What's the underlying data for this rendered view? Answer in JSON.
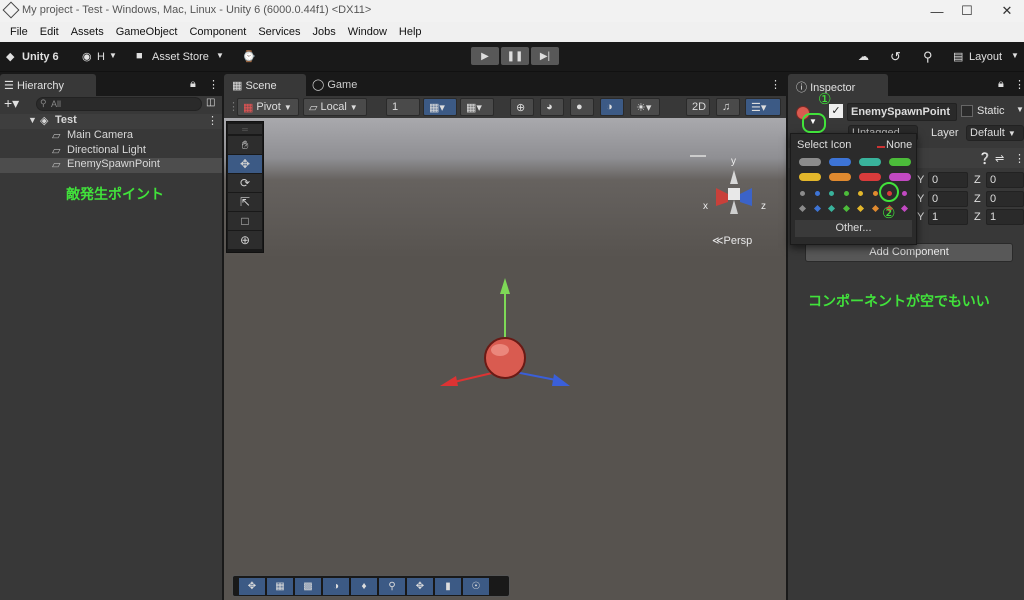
{
  "window": {
    "title": "My project - Test - Windows, Mac, Linux - Unity 6 (6000.0.44f1) <DX11>"
  },
  "menu": [
    "File",
    "Edit",
    "Assets",
    "GameObject",
    "Component",
    "Services",
    "Jobs",
    "Window",
    "Help"
  ],
  "toolbar": {
    "unity_label": "Unity 6",
    "account_label": "H",
    "asset_store_label": "Asset Store",
    "layout_label": "Layout"
  },
  "hierarchy": {
    "tab_label": "Hierarchy",
    "search_placeholder": "All",
    "scene_name": "Test",
    "items": [
      "Main Camera",
      "Directional Light",
      "EnemySpawnPoint"
    ]
  },
  "scene": {
    "tabs": [
      "Scene",
      "Game"
    ],
    "pivot_label": "Pivot",
    "local_label": "Local",
    "grid_size": "1",
    "persp_label": "Persp",
    "axis_x": "x",
    "axis_y": "y",
    "axis_z": "z"
  },
  "inspector": {
    "tab_label": "Inspector",
    "object_name": "EnemySpawnPoint",
    "static_label": "Static",
    "tag_value": "Untagged",
    "layer_label": "Layer",
    "layer_value": "Default",
    "transform_rows": [
      {
        "y": "0",
        "z": "0"
      },
      {
        "y": "0",
        "z": "0"
      },
      {
        "y": "1",
        "z": "1"
      }
    ],
    "y_label": "Y",
    "z_label": "Z",
    "add_component_label": "Add Component"
  },
  "icon_popup": {
    "title": "Select Icon",
    "none_label": "None",
    "other_label": "Other...",
    "pill_colors": [
      "#8c8c8c",
      "#3d74d6",
      "#39b39c",
      "#4cbc3a",
      "#e3b72b",
      "#e08a2f",
      "#d93b3b",
      "#c249c2"
    ],
    "dot_colors": [
      "#8c8c8c",
      "#3d74d6",
      "#39b39c",
      "#4cbc3a",
      "#e3b72b",
      "#e08a2f",
      "#d93b3b",
      "#c249c2"
    ]
  },
  "annotations": {
    "marker_1": "①",
    "marker_2": "②",
    "hierarchy_note": "敵発生ポイント",
    "inspector_note": "コンポーネントが空でもいい"
  }
}
